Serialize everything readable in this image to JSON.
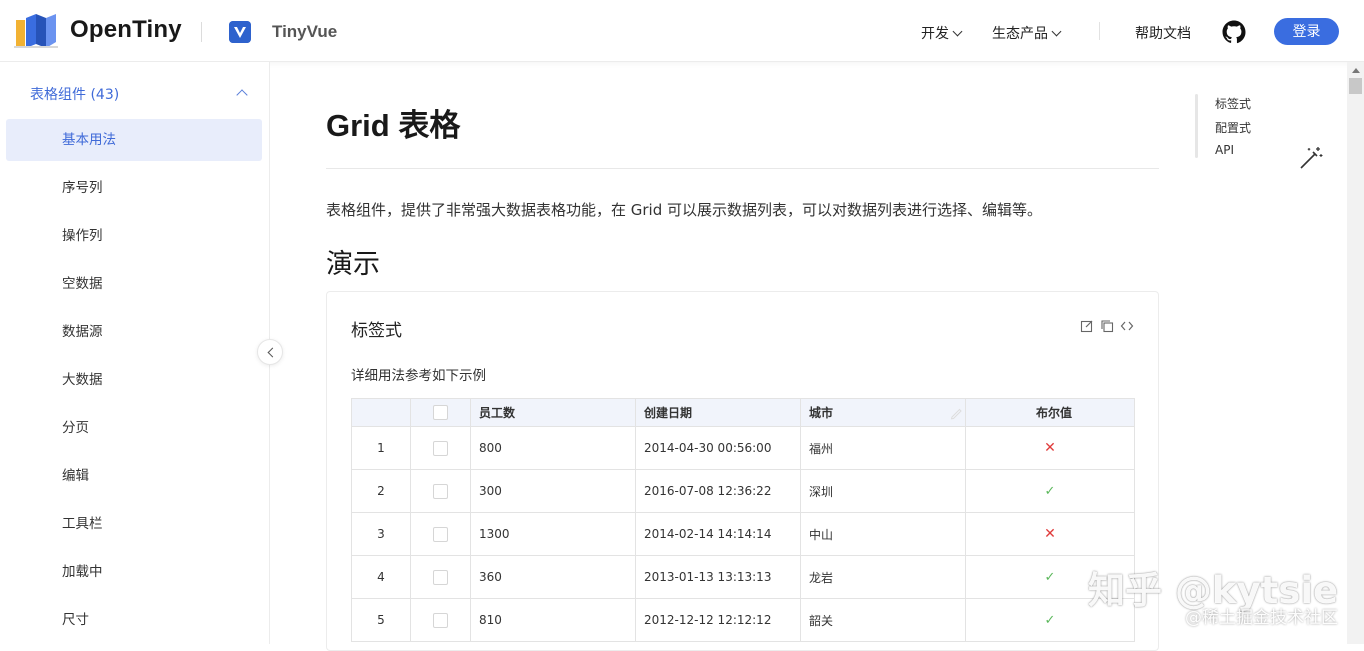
{
  "header": {
    "brand": "OpenTiny",
    "product": "TinyVue",
    "nav": [
      {
        "label": "开发"
      },
      {
        "label": "生态产品"
      }
    ],
    "docs_label": "帮助文档",
    "login_label": "登录"
  },
  "sidebar": {
    "group_title": "表格组件 (43)",
    "items": [
      {
        "label": "基本用法",
        "active": true
      },
      {
        "label": "序号列"
      },
      {
        "label": "操作列"
      },
      {
        "label": "空数据"
      },
      {
        "label": "数据源"
      },
      {
        "label": "大数据"
      },
      {
        "label": "分页"
      },
      {
        "label": "编辑"
      },
      {
        "label": "工具栏"
      },
      {
        "label": "加载中"
      },
      {
        "label": "尺寸"
      }
    ]
  },
  "main": {
    "title": "Grid 表格",
    "intro": "表格组件，提供了非常强大数据表格功能，在 Grid 可以展示数据列表，可以对数据列表进行选择、编辑等。",
    "section_title": "演示",
    "demo": {
      "title": "标签式",
      "desc": "详细用法参考如下示例",
      "columns": [
        "员工数",
        "创建日期",
        "城市",
        "布尔值"
      ],
      "rows": [
        {
          "index": "1",
          "employees": "800",
          "date": "2014-04-30 00:56:00",
          "city": "福州",
          "bool": false
        },
        {
          "index": "2",
          "employees": "300",
          "date": "2016-07-08 12:36:22",
          "city": "深圳",
          "bool": true
        },
        {
          "index": "3",
          "employees": "1300",
          "date": "2014-02-14 14:14:14",
          "city": "中山",
          "bool": false
        },
        {
          "index": "4",
          "employees": "360",
          "date": "2013-01-13 13:13:13",
          "city": "龙岩",
          "bool": true
        },
        {
          "index": "5",
          "employees": "810",
          "date": "2012-12-12 12:12:12",
          "city": "韶关",
          "bool": true
        }
      ]
    }
  },
  "toc": {
    "items": [
      "标签式",
      "配置式",
      "API"
    ]
  },
  "watermark": {
    "main": "知乎 @kytsie",
    "sub": "@稀土掘金技术社区"
  },
  "colors": {
    "accent": "#3f6ad8",
    "login_bg": "#3a6de0",
    "active_bg": "#e8edfb",
    "false_mark": "#e03b3b",
    "true_mark": "#5cb85c"
  },
  "icons": {
    "logo": "opentiny-logo",
    "product": "tinyvue-badge",
    "github": "github-icon",
    "edit": "edit-icon",
    "copy": "copy-icon",
    "code": "code-icon",
    "magic": "magic-wand-icon"
  }
}
